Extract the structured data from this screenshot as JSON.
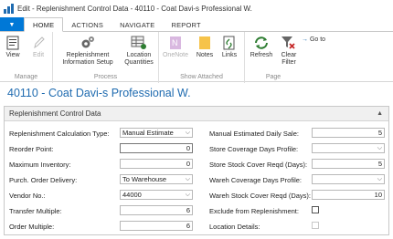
{
  "window": {
    "title": "Edit - Replenishment Control Data - 40110 - Coat Davi-s Professional W."
  },
  "ribbon_tabs": [
    {
      "label": "HOME",
      "active": true
    },
    {
      "label": "ACTIONS",
      "active": false
    },
    {
      "label": "NAVIGATE",
      "active": false
    },
    {
      "label": "REPORT",
      "active": false
    }
  ],
  "ribbon": {
    "groups": {
      "manage": "Manage",
      "process": "Process",
      "show_attached": "Show Attached",
      "page": "Page"
    },
    "buttons": {
      "view": "View",
      "edit": "Edit",
      "replenishment_line1": "Replenishment",
      "replenishment_line2": "Information Setup",
      "location_line1": "Location",
      "location_line2": "Quantities",
      "onenote": "OneNote",
      "notes": "Notes",
      "links": "Links",
      "refresh": "Refresh",
      "clear_filter_line1": "Clear",
      "clear_filter_line2": "Filter",
      "goto": "Go to"
    }
  },
  "page_title": "40110 - Coat Davi-s Professional W.",
  "section": {
    "title": "Replenishment Control Data",
    "left_fields": {
      "calc_type": {
        "label": "Replenishment Calculation Type:",
        "value": "Manual Estimate"
      },
      "reorder_point": {
        "label": "Reorder Point:",
        "value": "0"
      },
      "max_inventory": {
        "label": "Maximum Inventory:",
        "value": "0"
      },
      "purch_order_delivery": {
        "label": "Purch. Order Delivery:",
        "value": "To Warehouse"
      },
      "vendor_no": {
        "label": "Vendor No.:",
        "value": "44000"
      },
      "transfer_multiple": {
        "label": "Transfer Multiple:",
        "value": "6"
      },
      "order_multiple": {
        "label": "Order Multiple:",
        "value": "6"
      }
    },
    "right_fields": {
      "manual_est_daily_sale": {
        "label": "Manual Estimated Daily Sale:",
        "value": "5"
      },
      "store_cov_profile": {
        "label": "Store Coverage Days Profile:",
        "value": ""
      },
      "store_stock_cover": {
        "label": "Store Stock Cover Reqd (Days):",
        "value": "5"
      },
      "wareh_cov_profile": {
        "label": "Wareh Coverage Days Profile:",
        "value": ""
      },
      "wareh_stock_cover": {
        "label": "Wareh Stock Cover Reqd (Days):",
        "value": "10"
      },
      "exclude_from_repl": {
        "label": "Exclude from Replenishment:",
        "checked": false
      },
      "location_details": {
        "label": "Location Details:",
        "checked": false
      }
    }
  },
  "colors": {
    "accent": "#1f6bb0",
    "tab_blue": "#0078d7"
  }
}
